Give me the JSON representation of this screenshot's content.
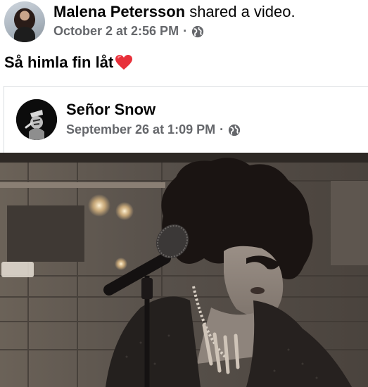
{
  "post": {
    "author_name": "Malena Petersson",
    "action_text": " shared a video.",
    "timestamp": "October 2 at 2:56 PM",
    "separator": "·",
    "audience_icon": "globe-icon",
    "text": "Så himla fin låt",
    "emoji": "red-heart-icon"
  },
  "shared": {
    "page_name": "Señor Snow",
    "timestamp": "September 26 at 1:09 PM",
    "separator": "·",
    "audience_icon": "globe-icon"
  },
  "colors": {
    "text_primary": "#050505",
    "text_secondary": "#65676b",
    "heart_red": "#e8303a",
    "card_border": "#dadde1"
  }
}
